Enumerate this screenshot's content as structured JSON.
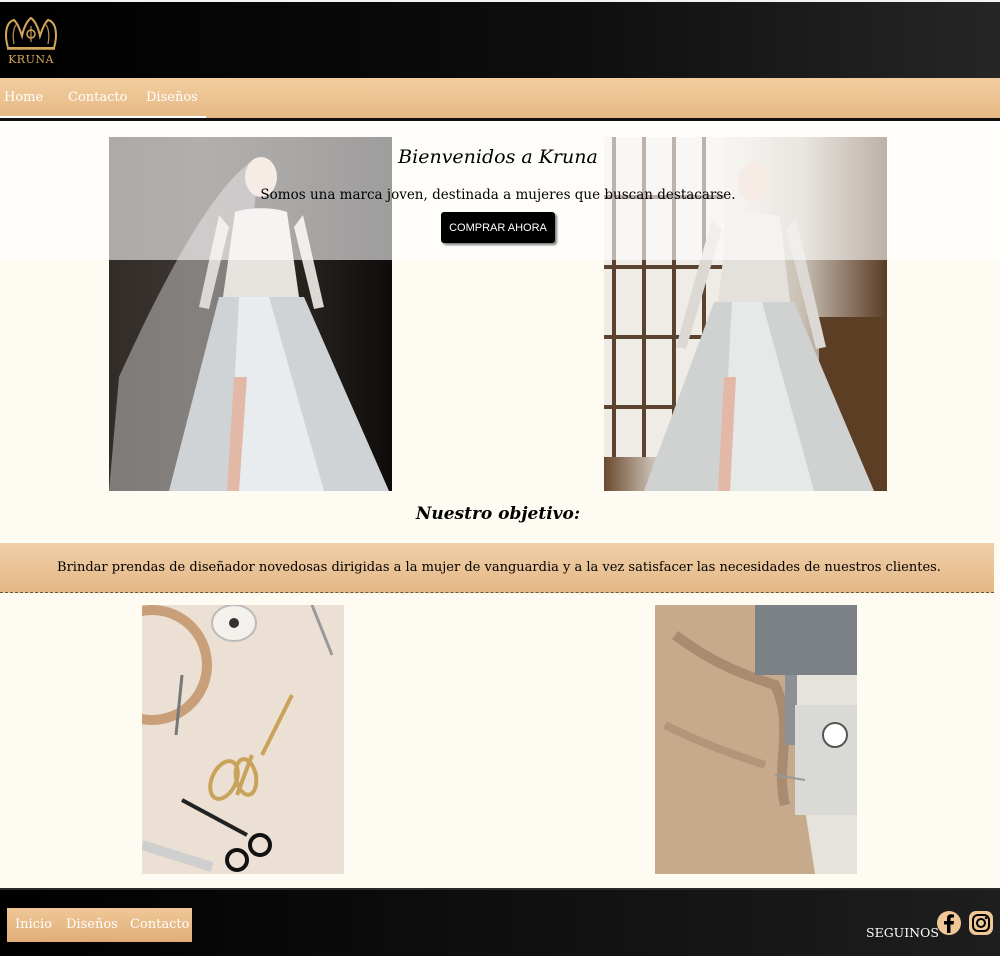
{
  "header": {
    "logo_text": "KRUNA"
  },
  "nav": {
    "items": [
      {
        "label": "Home"
      },
      {
        "label": "Contacto"
      },
      {
        "label": "Diseños"
      }
    ]
  },
  "hero": {
    "title": "Bienvenidos a Kruna",
    "subtitle": "Somos una marca joven, destinada a mujeres que buscan destacarse.",
    "button_label": "COMPRAR AHORA"
  },
  "objective": {
    "title": "Nuestro objetivo:",
    "text": "Brindar prendas de diseñador novedosas dirigidas a la mujer de vanguardia y a la vez satisfacer las necesidades de nuestros clientes."
  },
  "footer": {
    "links": [
      {
        "label": "Inicio"
      },
      {
        "label": "Diseños"
      },
      {
        "label": "Contacto"
      }
    ],
    "follow_label": "SEGUINOS",
    "social": [
      "facebook-icon",
      "instagram-icon"
    ]
  },
  "colors": {
    "accent": "#e6b985",
    "page_background": "#fdfbf2",
    "header_background": "#000000",
    "logo_gold": "#d4a85a"
  }
}
